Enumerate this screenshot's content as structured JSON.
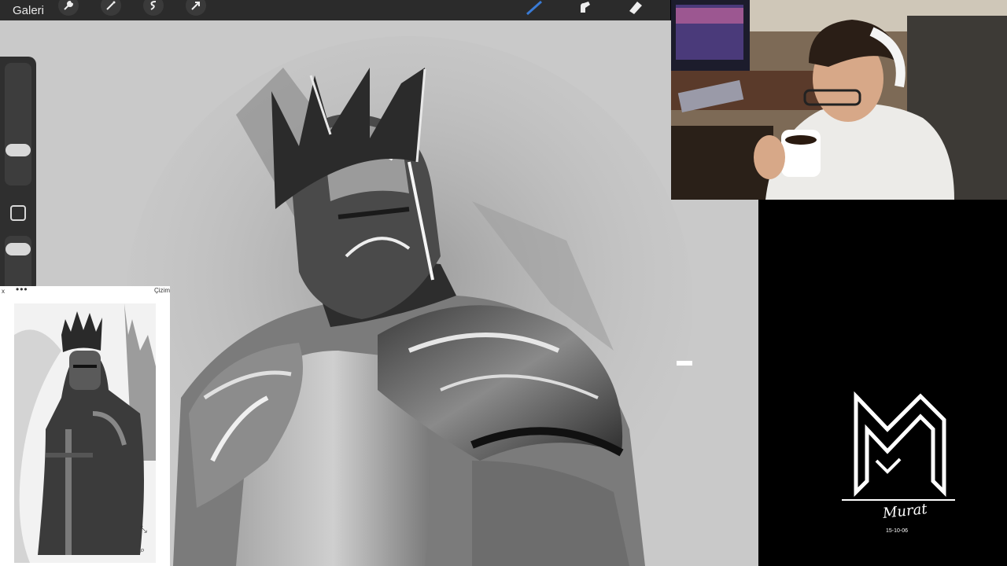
{
  "toolbar": {
    "gallery_label": "Galeri",
    "tools_left": [
      "wrench-icon",
      "magic-wand-icon",
      "selection-icon",
      "transform-arrow-icon"
    ],
    "tools_right": [
      "brush-icon",
      "smudge-icon",
      "eraser-icon"
    ],
    "active_color": "#3a7bd5"
  },
  "sidebar": {
    "controls": [
      "brush-size-slider",
      "modify-button",
      "opacity-slider"
    ]
  },
  "reference": {
    "more_label": "•••",
    "title": "Çizim",
    "close_label": "x"
  },
  "logo": {
    "signature": "Murat",
    "date": "15-10-06"
  },
  "colors": {
    "canvas_bg": "#c9c9c9",
    "toolbar_bg": "#2b2b2b",
    "panel_bg": "#000000"
  }
}
